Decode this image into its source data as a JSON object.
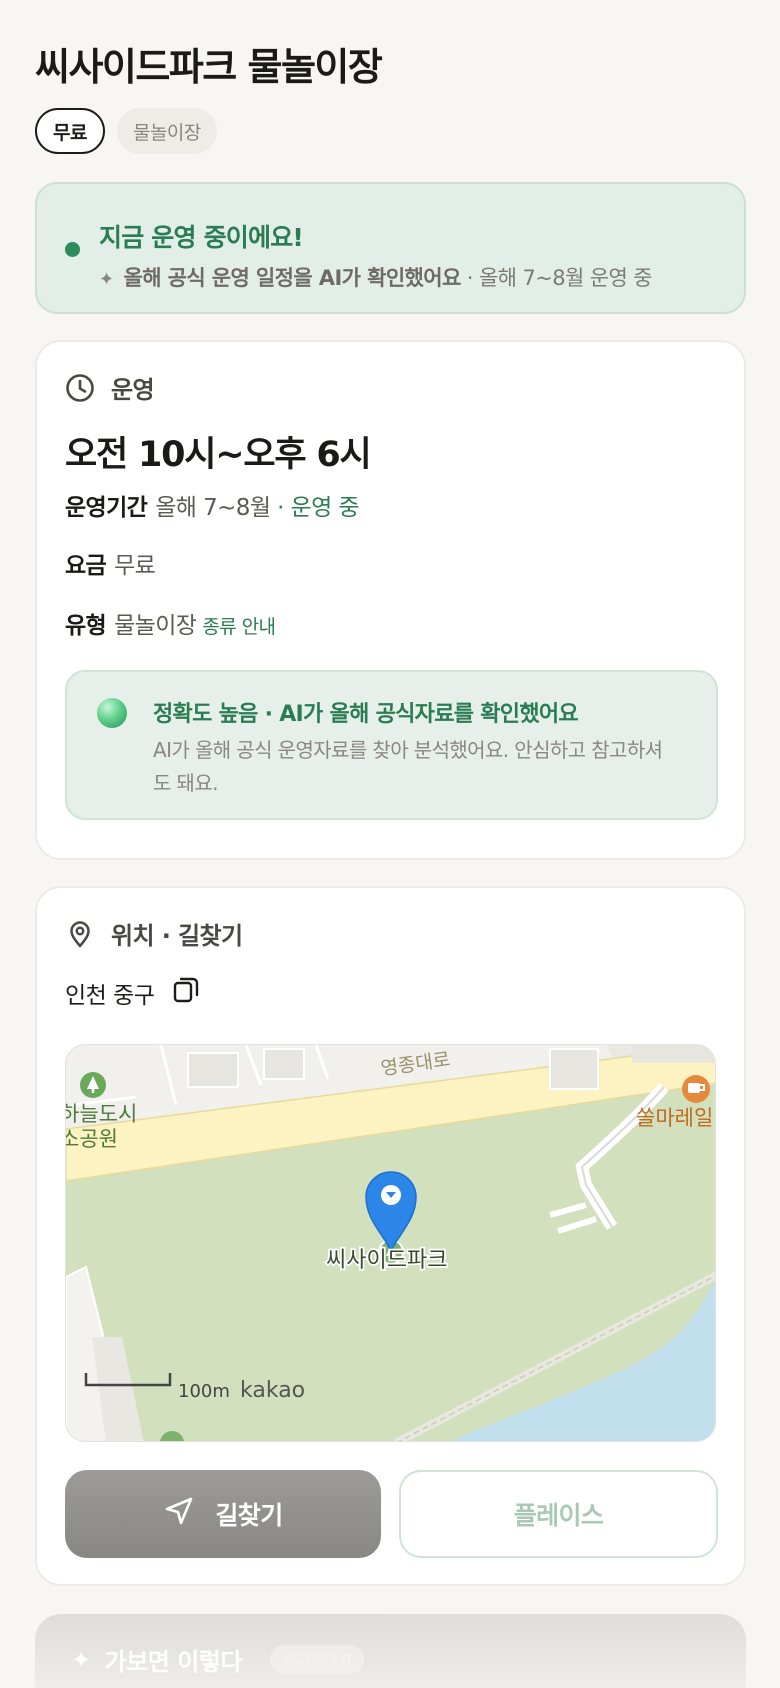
{
  "header": {
    "title": "씨사이드파크 물놀이장",
    "chips": [
      "무료",
      "물놀이장"
    ]
  },
  "status": {
    "headline": "지금 운영 중이에요!",
    "ai_note": "올해 공식 운영 일정을 AI가 확인했어요",
    "season_note": " · 올해 7~8월 운영 중"
  },
  "hours": {
    "section_label": "운영",
    "time": "오전 10시~오후 6시",
    "period_key": "운영기간",
    "period_value": "올해 7~8월",
    "period_status": " · 운영 중",
    "fee_key": "요금",
    "fee_value": "무료",
    "type_key": "유형",
    "type_value": "물놀이장",
    "type_link": "종류 안내"
  },
  "accuracy": {
    "headline": "정확도 높음 · AI가 올해 공식자료를 확인했어요",
    "body": "AI가 올해 공식 운영자료를 찾아 분석했어요. 안심하고 참고하셔도 돼요."
  },
  "location": {
    "section_label": "위치 · 길찾기",
    "address": "인천 중구",
    "map": {
      "road_label": "영종대로",
      "park_left_label_1": "하늘도시",
      "park_left_label_2": "소공원",
      "cafe_label": "쏠마레일",
      "place_label": "씨사이드파크",
      "scale_label": "100m",
      "brand": "kakao"
    },
    "route_button": "길찾기",
    "place_button": "플레이스"
  },
  "next_section": {
    "title": "가보면 이렇다",
    "badge": "후기업데 0"
  },
  "colors": {
    "accent_green": "#2a7d52",
    "status_bg": "#e3eee8",
    "map_grass": "#d3e0be",
    "map_road": "#fdf3c2",
    "map_water": "#c2dfee",
    "pin_blue": "#2b86e8"
  }
}
